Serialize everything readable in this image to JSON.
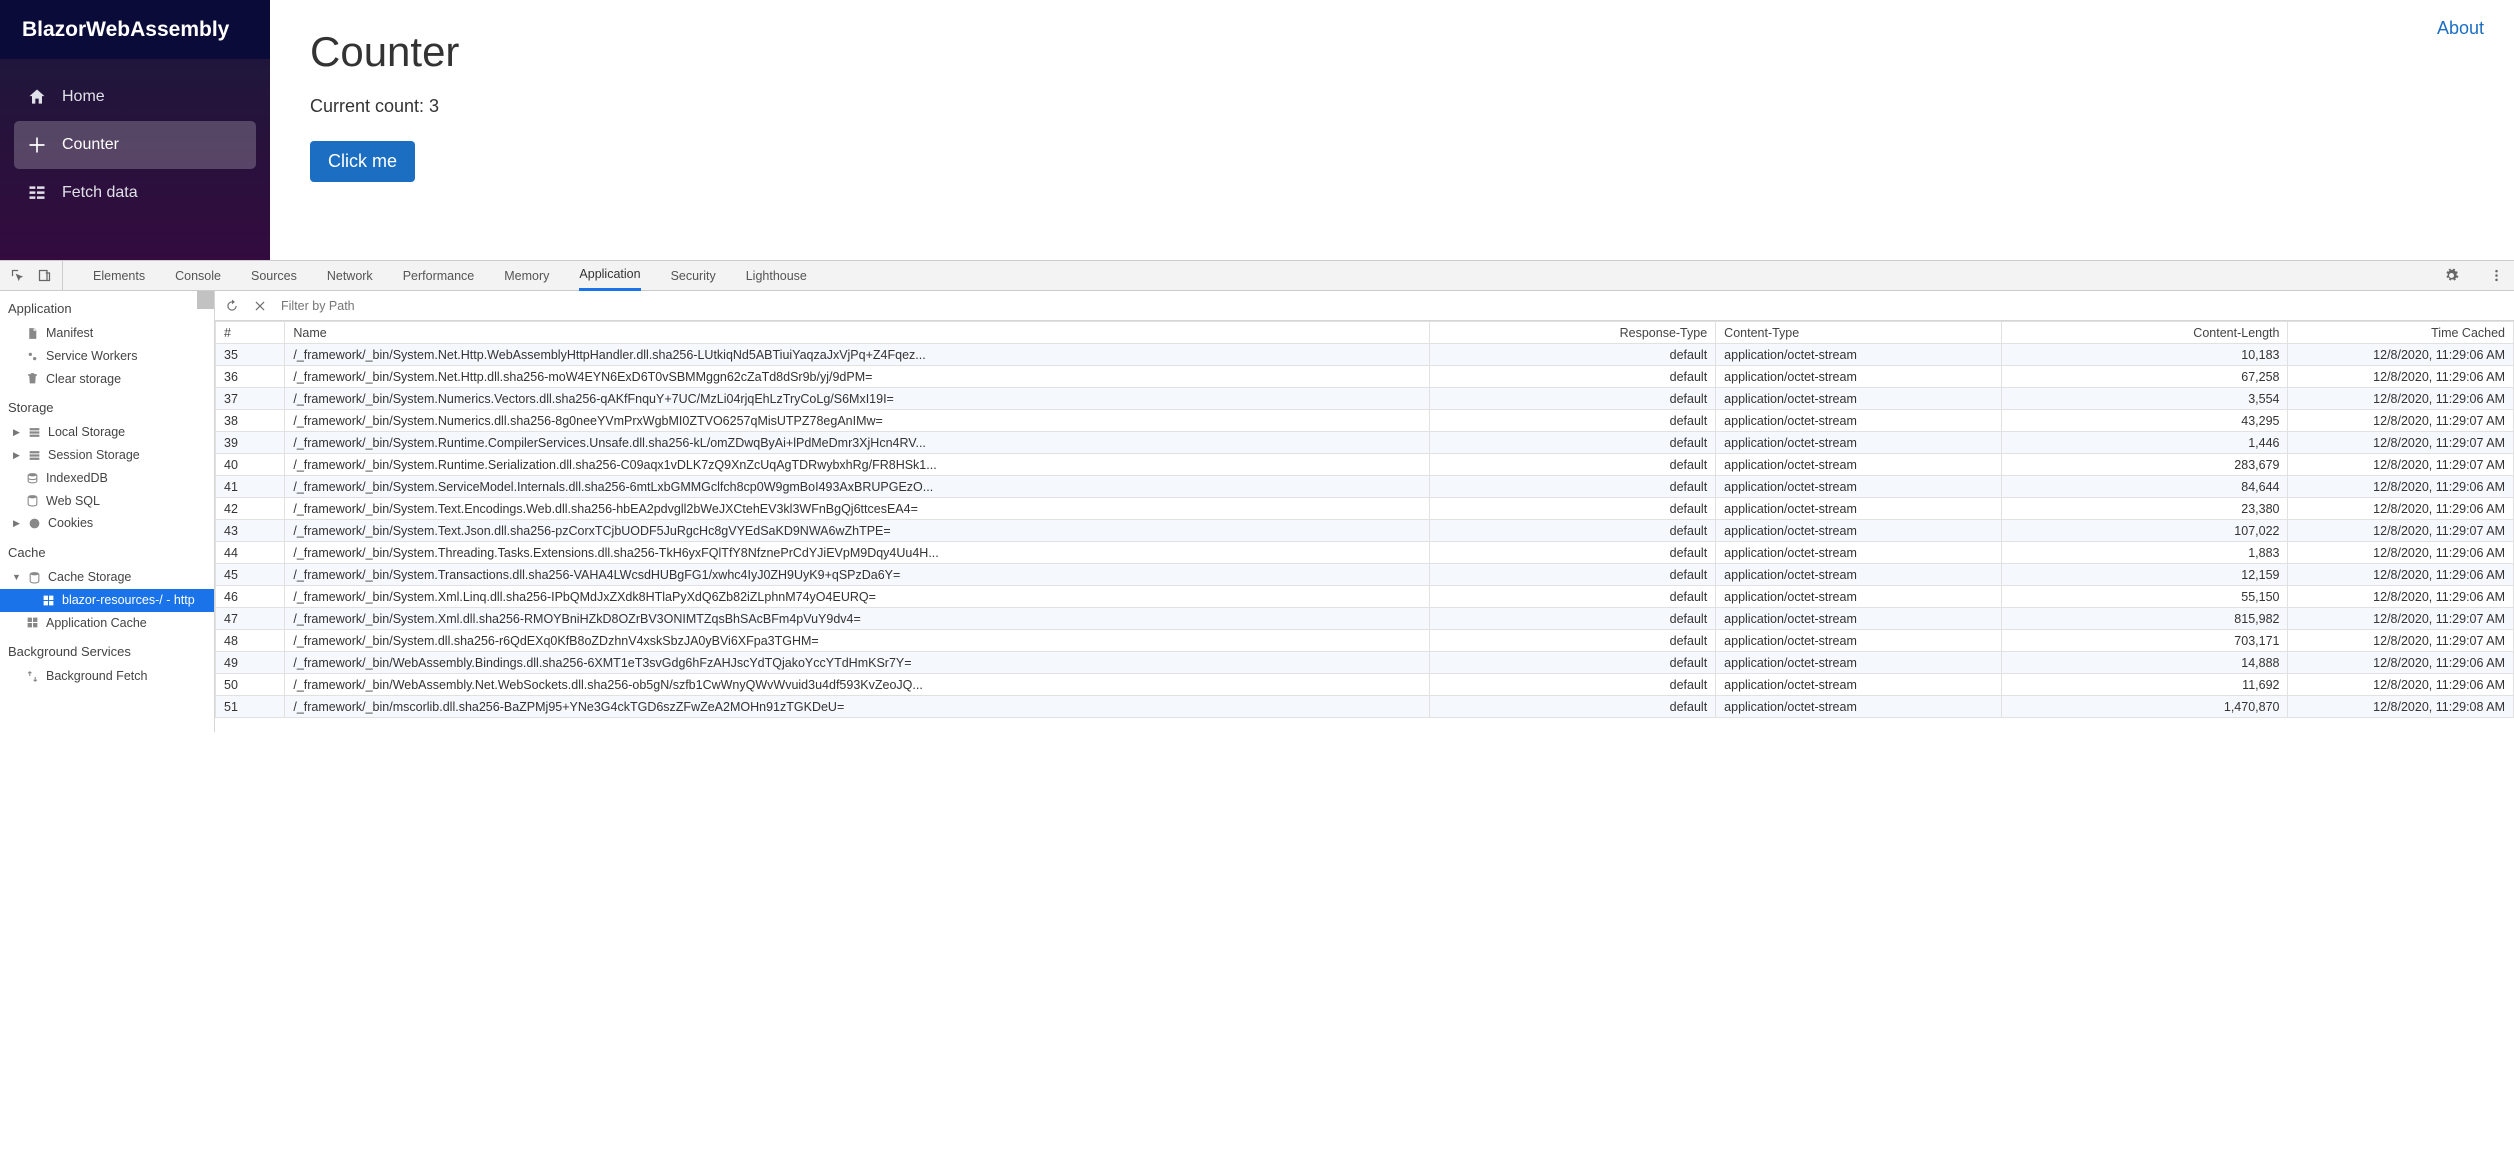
{
  "brand": "BlazorWebAssembly",
  "about": "About",
  "nav": [
    {
      "label": "Home"
    },
    {
      "label": "Counter"
    },
    {
      "label": "Fetch data"
    }
  ],
  "page": {
    "title": "Counter",
    "count_label": "Current count: 3",
    "button": "Click me"
  },
  "devtools": {
    "tabs": [
      "Elements",
      "Console",
      "Sources",
      "Network",
      "Performance",
      "Memory",
      "Application",
      "Security",
      "Lighthouse"
    ],
    "activeTab": "Application",
    "filter_placeholder": "Filter by Path",
    "side": {
      "app_section": "Application",
      "app_items": [
        "Manifest",
        "Service Workers",
        "Clear storage"
      ],
      "storage_section": "Storage",
      "storage_items": [
        "Local Storage",
        "Session Storage",
        "IndexedDB",
        "Web SQL",
        "Cookies"
      ],
      "cache_section": "Cache",
      "cache_storage": "Cache Storage",
      "cache_entry": "blazor-resources-/ - http",
      "app_cache": "Application Cache",
      "bg_section": "Background Services",
      "bg_fetch": "Background Fetch"
    },
    "columns": [
      "#",
      "Name",
      "Response-Type",
      "Content-Type",
      "Content-Length",
      "Time Cached"
    ],
    "rows": [
      {
        "idx": "35",
        "name": "/_framework/_bin/System.Net.Http.WebAssemblyHttpHandler.dll.sha256-LUtkiqNd5ABTiuiYaqzaJxVjPq+Z4Fqez...",
        "rtype": "default",
        "ctype": "application/octet-stream",
        "clen": "10,183",
        "time": "12/8/2020, 11:29:06 AM"
      },
      {
        "idx": "36",
        "name": "/_framework/_bin/System.Net.Http.dll.sha256-moW4EYN6ExD6T0vSBMMggn62cZaTd8dSr9b/yj/9dPM=",
        "rtype": "default",
        "ctype": "application/octet-stream",
        "clen": "67,258",
        "time": "12/8/2020, 11:29:06 AM"
      },
      {
        "idx": "37",
        "name": "/_framework/_bin/System.Numerics.Vectors.dll.sha256-qAKfFnquY+7UC/MzLi04rjqEhLzTryCoLg/S6MxI19I=",
        "rtype": "default",
        "ctype": "application/octet-stream",
        "clen": "3,554",
        "time": "12/8/2020, 11:29:06 AM"
      },
      {
        "idx": "38",
        "name": "/_framework/_bin/System.Numerics.dll.sha256-8g0neeYVmPrxWgbMI0ZTVO6257qMisUTPZ78egAnIMw=",
        "rtype": "default",
        "ctype": "application/octet-stream",
        "clen": "43,295",
        "time": "12/8/2020, 11:29:07 AM"
      },
      {
        "idx": "39",
        "name": "/_framework/_bin/System.Runtime.CompilerServices.Unsafe.dll.sha256-kL/omZDwqByAi+lPdMeDmr3XjHcn4RV...",
        "rtype": "default",
        "ctype": "application/octet-stream",
        "clen": "1,446",
        "time": "12/8/2020, 11:29:07 AM"
      },
      {
        "idx": "40",
        "name": "/_framework/_bin/System.Runtime.Serialization.dll.sha256-C09aqx1vDLK7zQ9XnZcUqAgTDRwybxhRg/FR8HSk1...",
        "rtype": "default",
        "ctype": "application/octet-stream",
        "clen": "283,679",
        "time": "12/8/2020, 11:29:07 AM"
      },
      {
        "idx": "41",
        "name": "/_framework/_bin/System.ServiceModel.Internals.dll.sha256-6mtLxbGMMGclfch8cp0W9gmBoI493AxBRUPGEzO...",
        "rtype": "default",
        "ctype": "application/octet-stream",
        "clen": "84,644",
        "time": "12/8/2020, 11:29:06 AM"
      },
      {
        "idx": "42",
        "name": "/_framework/_bin/System.Text.Encodings.Web.dll.sha256-hbEA2pdvgll2bWeJXCtehEV3kl3WFnBgQj6ttcesEA4=",
        "rtype": "default",
        "ctype": "application/octet-stream",
        "clen": "23,380",
        "time": "12/8/2020, 11:29:06 AM"
      },
      {
        "idx": "43",
        "name": "/_framework/_bin/System.Text.Json.dll.sha256-pzCorxTCjbUODF5JuRgcHc8gVYEdSaKD9NWA6wZhTPE=",
        "rtype": "default",
        "ctype": "application/octet-stream",
        "clen": "107,022",
        "time": "12/8/2020, 11:29:07 AM"
      },
      {
        "idx": "44",
        "name": "/_framework/_bin/System.Threading.Tasks.Extensions.dll.sha256-TkH6yxFQlTfY8NfznePrCdYJiEVpM9Dqy4Uu4H...",
        "rtype": "default",
        "ctype": "application/octet-stream",
        "clen": "1,883",
        "time": "12/8/2020, 11:29:06 AM"
      },
      {
        "idx": "45",
        "name": "/_framework/_bin/System.Transactions.dll.sha256-VAHA4LWcsdHUBgFG1/xwhc4IyJ0ZH9UyK9+qSPzDa6Y=",
        "rtype": "default",
        "ctype": "application/octet-stream",
        "clen": "12,159",
        "time": "12/8/2020, 11:29:06 AM"
      },
      {
        "idx": "46",
        "name": "/_framework/_bin/System.Xml.Linq.dll.sha256-IPbQMdJxZXdk8HTlaPyXdQ6Zb82iZLphnM74yO4EURQ=",
        "rtype": "default",
        "ctype": "application/octet-stream",
        "clen": "55,150",
        "time": "12/8/2020, 11:29:06 AM"
      },
      {
        "idx": "47",
        "name": "/_framework/_bin/System.Xml.dll.sha256-RMOYBniHZkD8OZrBV3ONIMTZqsBhSAcBFm4pVuY9dv4=",
        "rtype": "default",
        "ctype": "application/octet-stream",
        "clen": "815,982",
        "time": "12/8/2020, 11:29:07 AM"
      },
      {
        "idx": "48",
        "name": "/_framework/_bin/System.dll.sha256-r6QdEXq0KfB8oZDzhnV4xskSbzJA0yBVi6XFpa3TGHM=",
        "rtype": "default",
        "ctype": "application/octet-stream",
        "clen": "703,171",
        "time": "12/8/2020, 11:29:07 AM"
      },
      {
        "idx": "49",
        "name": "/_framework/_bin/WebAssembly.Bindings.dll.sha256-6XMT1eT3svGdg6hFzAHJscYdTQjakoYccYTdHmKSr7Y=",
        "rtype": "default",
        "ctype": "application/octet-stream",
        "clen": "14,888",
        "time": "12/8/2020, 11:29:06 AM"
      },
      {
        "idx": "50",
        "name": "/_framework/_bin/WebAssembly.Net.WebSockets.dll.sha256-ob5gN/szfb1CwWnyQWvWvuid3u4df593KvZeoJQ...",
        "rtype": "default",
        "ctype": "application/octet-stream",
        "clen": "11,692",
        "time": "12/8/2020, 11:29:06 AM"
      },
      {
        "idx": "51",
        "name": "/_framework/_bin/mscorlib.dll.sha256-BaZPMj95+YNe3G4ckTGD6szZFwZeA2MOHn91zTGKDeU=",
        "rtype": "default",
        "ctype": "application/octet-stream",
        "clen": "1,470,870",
        "time": "12/8/2020, 11:29:08 AM"
      }
    ]
  }
}
